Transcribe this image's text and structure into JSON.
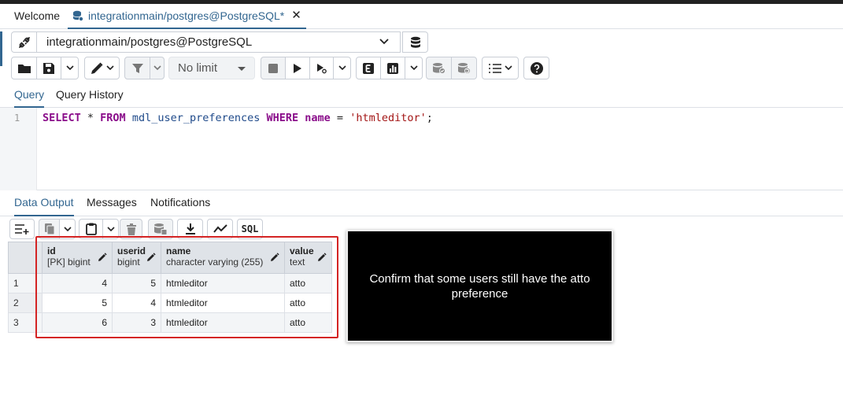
{
  "tabs": {
    "welcome": "Welcome",
    "query_tab": "integrationmain/postgres@PostgreSQL*",
    "close_glyph": "✕"
  },
  "connection": {
    "selected": "integrationmain/postgres@PostgreSQL"
  },
  "toolbar": {
    "limit_label": "No limit"
  },
  "query_tabs": [
    "Query",
    "Query History"
  ],
  "editor": {
    "line_number": "1",
    "tokens": {
      "select": "SELECT",
      "star": " * ",
      "from": "FROM",
      "table": " mdl_user_preferences ",
      "where": "WHERE",
      "col": " name ",
      "eq": "= ",
      "literal": "'htmleditor'",
      "semi": ";"
    }
  },
  "output_tabs": [
    "Data Output",
    "Messages",
    "Notifications"
  ],
  "result_toolbar": {
    "sql_label": "SQL"
  },
  "results": {
    "columns": [
      {
        "name": "id",
        "type": "[PK] bigint"
      },
      {
        "name": "userid",
        "type": "bigint"
      },
      {
        "name": "name",
        "type": "character varying (255)"
      },
      {
        "name": "value",
        "type": "text"
      }
    ],
    "rows": [
      {
        "rownum": "1",
        "id": "4",
        "userid": "5",
        "name": "htmleditor",
        "value": "atto"
      },
      {
        "rownum": "2",
        "id": "5",
        "userid": "4",
        "name": "htmleditor",
        "value": "atto"
      },
      {
        "rownum": "3",
        "id": "6",
        "userid": "3",
        "name": "htmleditor",
        "value": "atto"
      }
    ]
  },
  "annotation": {
    "text": "Confirm that some users still have the atto preference"
  },
  "colors": {
    "accent": "#326690",
    "highlight_box": "#d42424",
    "callout_bg": "#000000"
  }
}
